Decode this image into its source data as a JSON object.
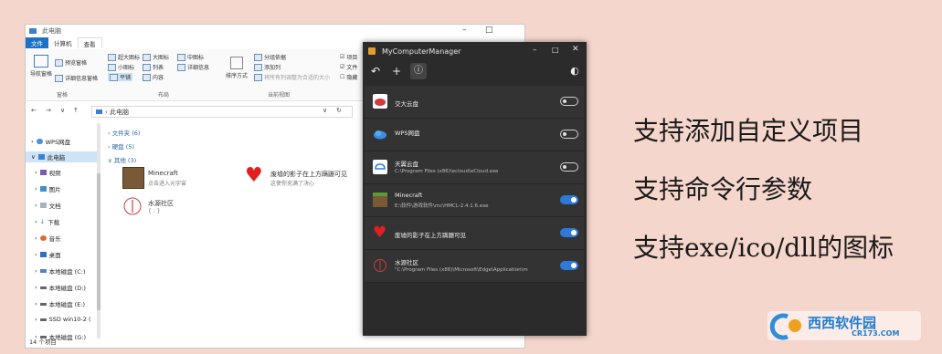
{
  "explorer": {
    "title": "此电脑",
    "tabs": [
      "文件",
      "计算机",
      "查看"
    ],
    "ribbon": {
      "nav_pane": "导航窗格",
      "preview_pane": "预览窗格",
      "details_pane": "详细信息窗格",
      "layout_items": [
        "超大图标",
        "大图标",
        "中图标",
        "小图标",
        "列表",
        "详细信息",
        "平铺",
        "内容"
      ],
      "sort_by": "排序方式",
      "group_by": "分组依据",
      "add_column": "添加列",
      "fit_columns": "将所有列调整为合适的大小",
      "checkbox_item": "项目",
      "checkbox_ext": "文件",
      "checkbox_hidden": "隐藏",
      "group_panes": "窗格",
      "group_layout": "布局",
      "group_view": "当前视图"
    },
    "address": "此电脑",
    "nav": [
      "WPS网盘",
      "此电脑",
      "视频",
      "图片",
      "文档",
      "下载",
      "音乐",
      "桌面",
      "本地磁盘 (C:)",
      "本地磁盘 (D:)",
      "本地磁盘 (E:)",
      "SSD win10-2 (",
      "本地磁盘 (G:)"
    ],
    "sections": {
      "folders": "文件夹 (6)",
      "drives": "硬盘 (5)",
      "other": "其他 (3)"
    },
    "items": [
      {
        "name": "Minecraft",
        "desc": "点击进入元宇宙"
      },
      {
        "name": "废墟的影子在上方蹒跚可见",
        "desc": "这使你充满了决心"
      },
      {
        "name": "水源社区",
        "desc": "{ : }"
      }
    ],
    "status": "14 个项目"
  },
  "app": {
    "title": "MyComputerManager",
    "toolbar": {
      "undo": "↶",
      "add": "+",
      "info": "ⓘ",
      "theme": "◐"
    },
    "rows": [
      {
        "name": "交大云盘",
        "path": "",
        "enabled": false,
        "icon": "cloud-red-icon"
      },
      {
        "name": "WPS网盘",
        "path": "",
        "enabled": false,
        "icon": "wps-cloud-icon"
      },
      {
        "name": "天翼云盘",
        "path": "C:\\Program Files (x86)\\ecloud\\eCloud.exe",
        "enabled": false,
        "icon": "ecloud-icon"
      },
      {
        "name": "Minecraft",
        "path": "E:\\软件\\游戏软件\\mc\\HMCL-2.4.1.6.exe",
        "enabled": true,
        "icon": "minecraft-icon"
      },
      {
        "name": "废墟的影子在上方蹒跚可见",
        "path": "",
        "enabled": true,
        "icon": "heart-icon"
      },
      {
        "name": "水源社区",
        "path": "\"C:\\Program Files (x86)\\Microsoft\\Edge\\Application\\m",
        "enabled": true,
        "icon": "shuiyuan-icon"
      }
    ]
  },
  "features": [
    "支持添加自定义项目",
    "支持命令行参数",
    "支持exe/ico/dll的图标"
  ],
  "watermark": {
    "text": "西西软件园",
    "url": "CR173.COM"
  },
  "colors": {
    "background": "#f5d6cc",
    "accent": "#2f7ad8",
    "app_bg": "#2b2b2b"
  }
}
